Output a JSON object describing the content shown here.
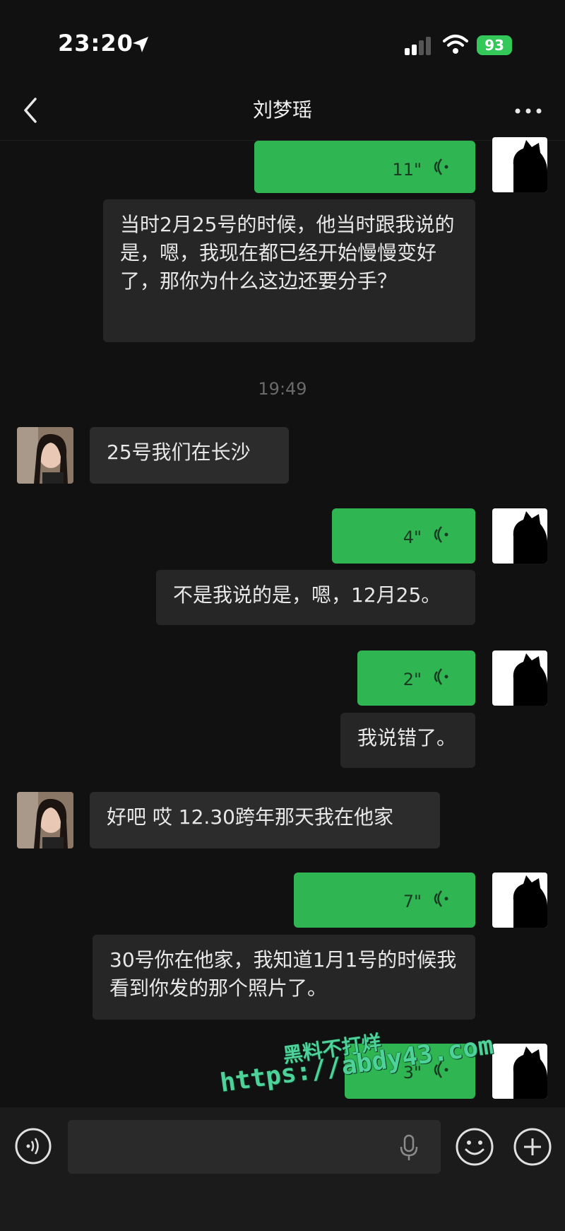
{
  "status_bar": {
    "time": "23:20",
    "battery": "93"
  },
  "nav": {
    "title": "刘梦瑶"
  },
  "messages": [
    {
      "side": "me",
      "type": "voice",
      "duration": "11\""
    },
    {
      "side": "me",
      "type": "text",
      "text": "当时2月25号的时候，他当时跟我说的是，嗯，我现在都已经开始慢慢变好了，那你为什么这边还要分手？"
    },
    {
      "side": "her",
      "type": "text",
      "text": "25号我们在长沙"
    },
    {
      "side": "me",
      "type": "voice",
      "duration": "4\""
    },
    {
      "side": "me",
      "type": "text",
      "text": "不是我说的是，嗯，12月25。"
    },
    {
      "side": "me",
      "type": "voice",
      "duration": "2\""
    },
    {
      "side": "me",
      "type": "text",
      "text": "我说错了。"
    },
    {
      "side": "her",
      "type": "text",
      "text": "好吧 哎 12.30跨年那天我在他家"
    },
    {
      "side": "me",
      "type": "voice",
      "duration": "7\""
    },
    {
      "side": "me",
      "type": "text",
      "text": "30号你在他家，我知道1月1号的时候我看到你发的那个照片了。"
    },
    {
      "side": "me",
      "type": "voice",
      "duration": "3\""
    }
  ],
  "timestamp": "19:49",
  "watermark": {
    "line1": "黑料不打烊",
    "line2": "https://abdy43.com"
  },
  "colors": {
    "voice_bubble": "#2fb652",
    "background": "#111111"
  }
}
